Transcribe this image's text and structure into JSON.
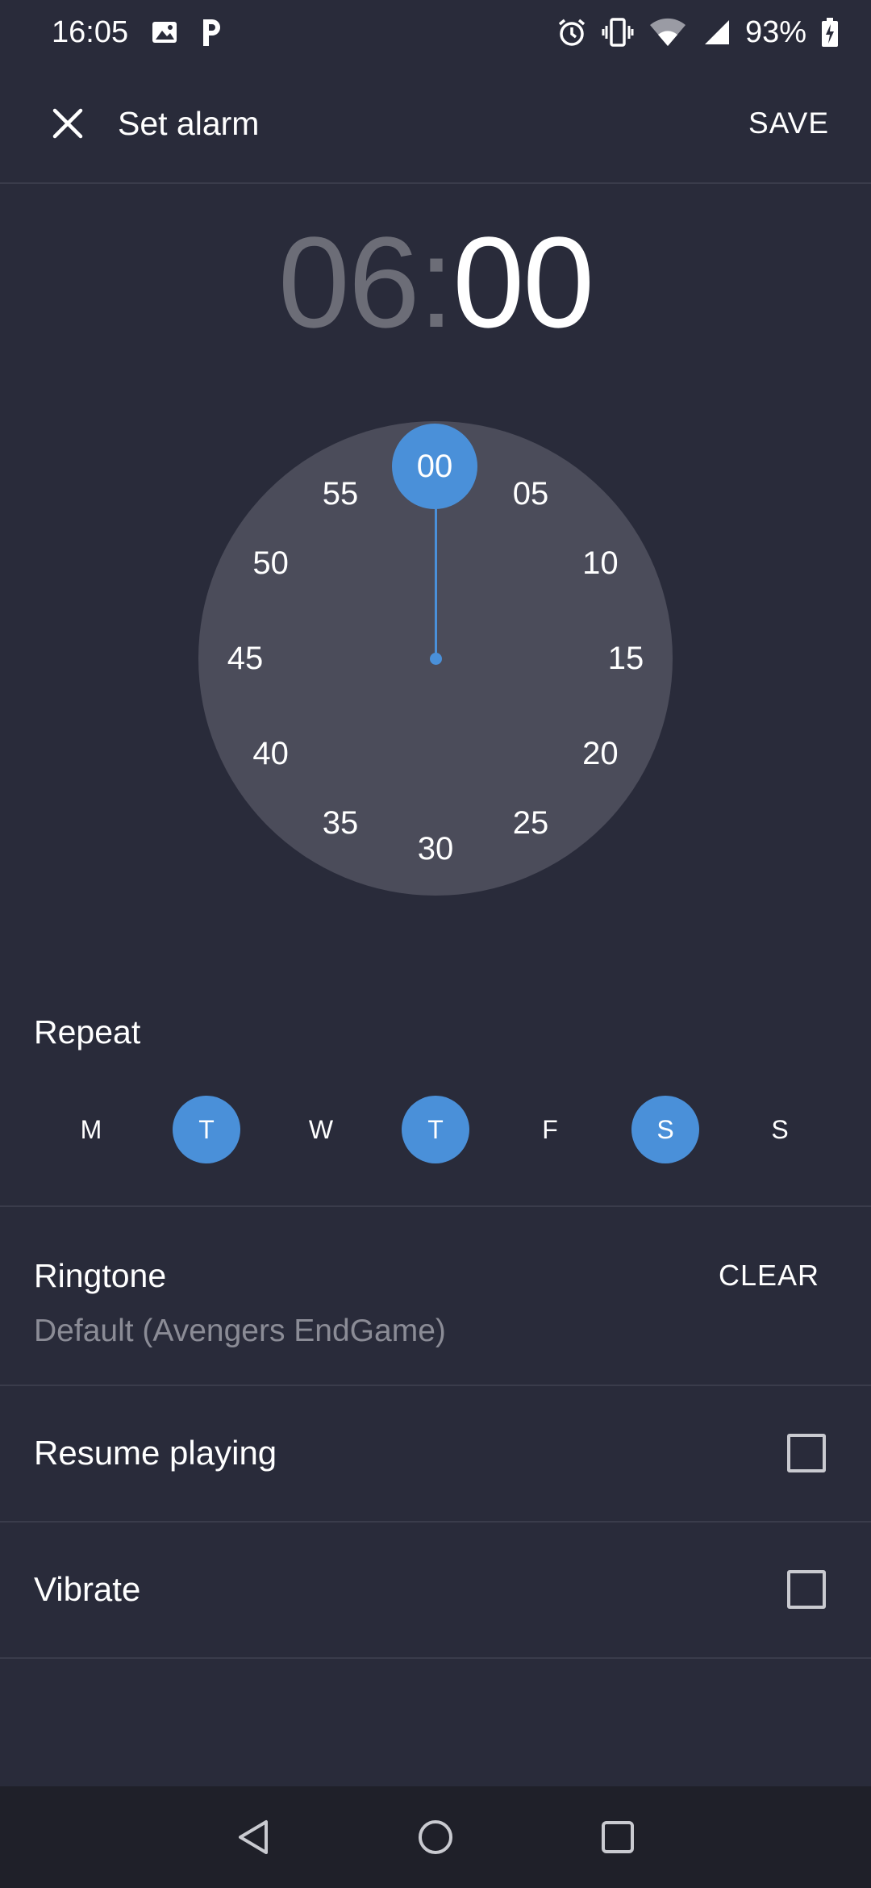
{
  "status_bar": {
    "time": "16:05",
    "battery_percent": "93%",
    "icons": [
      "image-icon",
      "parking-icon",
      "alarm-icon",
      "vibrate-icon",
      "wifi-icon",
      "signal-icon",
      "battery-charging-icon"
    ]
  },
  "app_bar": {
    "title": "Set alarm",
    "save_label": "SAVE"
  },
  "time": {
    "hour": "06",
    "separator": ":",
    "minute": "00",
    "active_part": "minute"
  },
  "dial": {
    "selected": "00",
    "numbers": [
      "05",
      "10",
      "15",
      "20",
      "25",
      "30",
      "35",
      "40",
      "45",
      "50",
      "55"
    ]
  },
  "repeat": {
    "label": "Repeat",
    "days": [
      {
        "label": "M",
        "selected": false
      },
      {
        "label": "T",
        "selected": true
      },
      {
        "label": "W",
        "selected": false
      },
      {
        "label": "T",
        "selected": true
      },
      {
        "label": "F",
        "selected": false
      },
      {
        "label": "S",
        "selected": true
      },
      {
        "label": "S",
        "selected": false
      }
    ]
  },
  "ringtone": {
    "label": "Ringtone",
    "value": "Default (Avengers EndGame)",
    "clear_label": "CLEAR"
  },
  "options": {
    "resume_playing": {
      "label": "Resume playing",
      "checked": false
    },
    "vibrate": {
      "label": "Vibrate",
      "checked": false
    }
  },
  "colors": {
    "background": "#292b3a",
    "accent": "#4a90d9",
    "dial": "#4b4c5a",
    "muted_text": "#8b8c96",
    "nav_bar": "#1f2029"
  }
}
